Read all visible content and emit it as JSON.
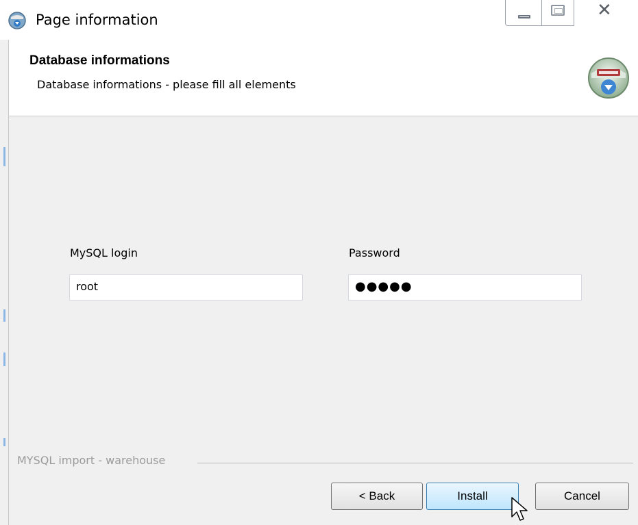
{
  "window": {
    "title": "Page information"
  },
  "header": {
    "title": "Database informations",
    "subtitle": "Database informations - please fill all elements",
    "icon": "install-badge-icon"
  },
  "form": {
    "login_label": "MySQL login",
    "login_value": "root",
    "password_label": "Password",
    "password_value": "●●●●●"
  },
  "footer": {
    "group_label": "MYSQL import - warehouse",
    "back_label": "< Back",
    "install_label": "Install",
    "cancel_label": "Cancel"
  },
  "colors": {
    "install_button_accent": "#bee6fd",
    "header_background": "#ffffff",
    "body_background": "#f0f0f0"
  }
}
